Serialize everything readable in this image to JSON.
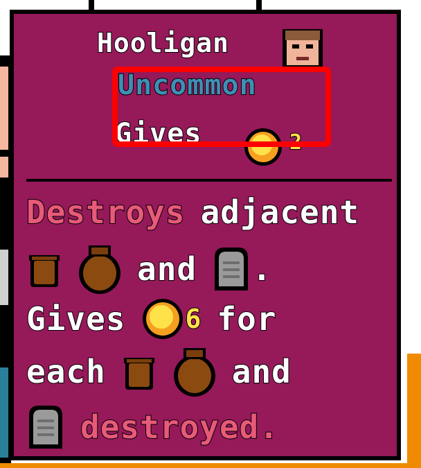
{
  "item": {
    "name": "Hooligan",
    "rarity": "Uncommon",
    "gives_label": "Gives",
    "gives_value": "2"
  },
  "description": {
    "line1": [
      "Destroys",
      "adjacent"
    ],
    "line2_and": "and",
    "line2_period": ".",
    "line3": [
      "Gives",
      "6",
      "for"
    ],
    "line4": [
      "each",
      "and"
    ],
    "line5": "destroyed."
  },
  "icons": {
    "avatar": "hooligan-face-icon",
    "coin": "coin-icon",
    "urn_small": "small-urn-icon",
    "urn_big": "big-urn-icon",
    "tombstone": "tombstone-icon"
  },
  "colors": {
    "panel": "#96195a",
    "rarity": "#3f8fb5",
    "keyword": "#e85a78",
    "number": "#ffe14a",
    "highlight": "#ff0000"
  }
}
